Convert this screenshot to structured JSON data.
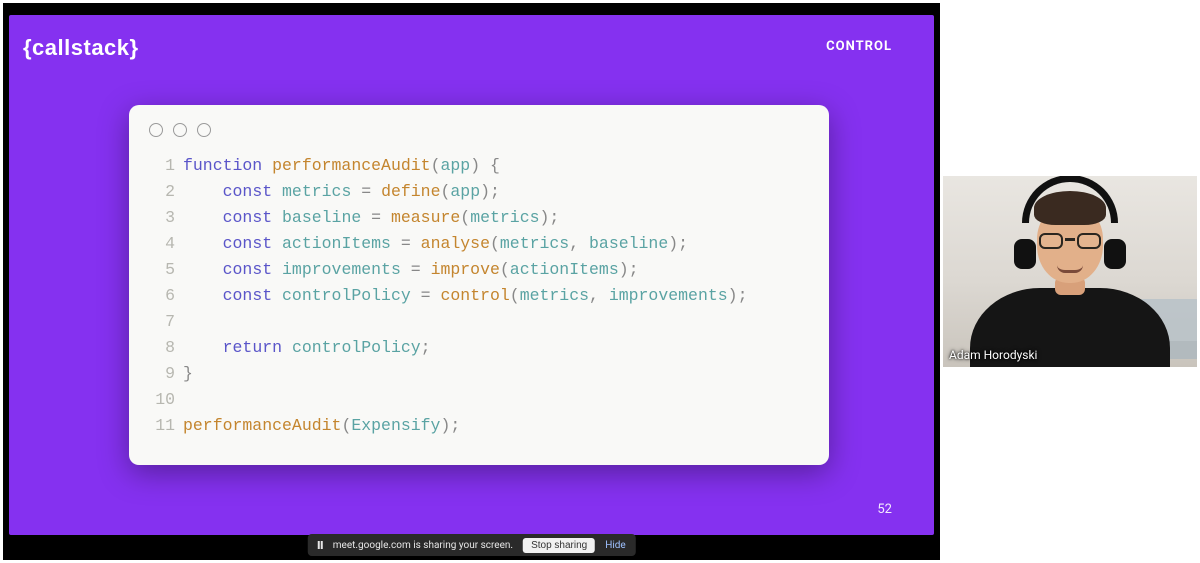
{
  "slide": {
    "brand": "{callstack}",
    "tag": "CONTROL",
    "page_number": "52",
    "accent_color": "#8531f0"
  },
  "code": {
    "lines": [
      {
        "n": "1",
        "tokens": [
          [
            "kw",
            "function"
          ],
          [
            "sp",
            " "
          ],
          [
            "fn",
            "performanceAudit"
          ],
          [
            "pun",
            "("
          ],
          [
            "var",
            "app"
          ],
          [
            "pun",
            ")"
          ],
          [
            "sp",
            " "
          ],
          [
            "pun",
            "{"
          ]
        ]
      },
      {
        "n": "2",
        "tokens": [
          [
            "sp",
            "    "
          ],
          [
            "kw",
            "const"
          ],
          [
            "sp",
            " "
          ],
          [
            "var",
            "metrics"
          ],
          [
            "sp",
            " "
          ],
          [
            "pun",
            "="
          ],
          [
            "sp",
            " "
          ],
          [
            "fn",
            "define"
          ],
          [
            "pun",
            "("
          ],
          [
            "var",
            "app"
          ],
          [
            "pun",
            ")"
          ],
          [
            "pun",
            ";"
          ]
        ]
      },
      {
        "n": "3",
        "tokens": [
          [
            "sp",
            "    "
          ],
          [
            "kw",
            "const"
          ],
          [
            "sp",
            " "
          ],
          [
            "var",
            "baseline"
          ],
          [
            "sp",
            " "
          ],
          [
            "pun",
            "="
          ],
          [
            "sp",
            " "
          ],
          [
            "fn",
            "measure"
          ],
          [
            "pun",
            "("
          ],
          [
            "var",
            "metrics"
          ],
          [
            "pun",
            ")"
          ],
          [
            "pun",
            ";"
          ]
        ]
      },
      {
        "n": "4",
        "tokens": [
          [
            "sp",
            "    "
          ],
          [
            "kw",
            "const"
          ],
          [
            "sp",
            " "
          ],
          [
            "var",
            "actionItems"
          ],
          [
            "sp",
            " "
          ],
          [
            "pun",
            "="
          ],
          [
            "sp",
            " "
          ],
          [
            "fn",
            "analyse"
          ],
          [
            "pun",
            "("
          ],
          [
            "var",
            "metrics"
          ],
          [
            "pun",
            ","
          ],
          [
            "sp",
            " "
          ],
          [
            "var",
            "baseline"
          ],
          [
            "pun",
            ")"
          ],
          [
            "pun",
            ";"
          ]
        ]
      },
      {
        "n": "5",
        "tokens": [
          [
            "sp",
            "    "
          ],
          [
            "kw",
            "const"
          ],
          [
            "sp",
            " "
          ],
          [
            "var",
            "improvements"
          ],
          [
            "sp",
            " "
          ],
          [
            "pun",
            "="
          ],
          [
            "sp",
            " "
          ],
          [
            "fn",
            "improve"
          ],
          [
            "pun",
            "("
          ],
          [
            "var",
            "actionItems"
          ],
          [
            "pun",
            ")"
          ],
          [
            "pun",
            ";"
          ]
        ]
      },
      {
        "n": "6",
        "tokens": [
          [
            "sp",
            "    "
          ],
          [
            "kw",
            "const"
          ],
          [
            "sp",
            " "
          ],
          [
            "var",
            "controlPolicy"
          ],
          [
            "sp",
            " "
          ],
          [
            "pun",
            "="
          ],
          [
            "sp",
            " "
          ],
          [
            "fn",
            "control"
          ],
          [
            "pun",
            "("
          ],
          [
            "var",
            "metrics"
          ],
          [
            "pun",
            ","
          ],
          [
            "sp",
            " "
          ],
          [
            "var",
            "improvements"
          ],
          [
            "pun",
            ")"
          ],
          [
            "pun",
            ";"
          ]
        ]
      },
      {
        "n": "7",
        "tokens": []
      },
      {
        "n": "8",
        "tokens": [
          [
            "sp",
            "    "
          ],
          [
            "kw",
            "return"
          ],
          [
            "sp",
            " "
          ],
          [
            "var",
            "controlPolicy"
          ],
          [
            "pun",
            ";"
          ]
        ]
      },
      {
        "n": "9",
        "tokens": [
          [
            "pun",
            "}"
          ]
        ]
      },
      {
        "n": "10",
        "tokens": []
      },
      {
        "n": "11",
        "tokens": [
          [
            "fn",
            "performanceAudit"
          ],
          [
            "pun",
            "("
          ],
          [
            "var",
            "Expensify"
          ],
          [
            "pun",
            ")"
          ],
          [
            "pun",
            ";"
          ]
        ]
      }
    ]
  },
  "share_toast": {
    "message": "meet.google.com is sharing your screen.",
    "stop": "Stop sharing",
    "hide": "Hide"
  },
  "participant": {
    "name": "Adam Horodyski"
  }
}
